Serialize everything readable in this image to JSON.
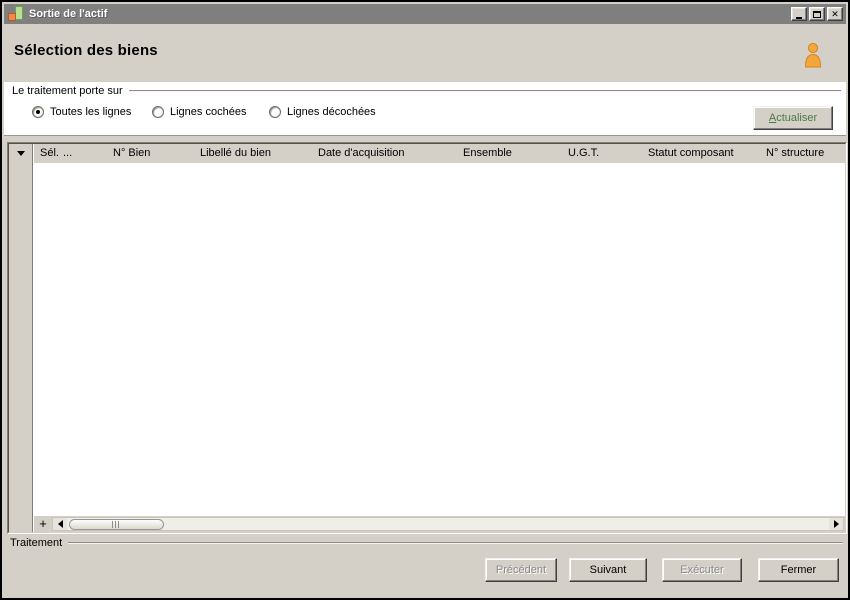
{
  "window": {
    "title": "Sortie de l'actif"
  },
  "page": {
    "heading": "Sélection des biens"
  },
  "filter_panel": {
    "legend": "Le traitement porte sur",
    "options": [
      {
        "label": "Toutes les lignes",
        "selected": true
      },
      {
        "label": "Lignes cochées",
        "selected": false
      },
      {
        "label": "Lignes décochées",
        "selected": false
      }
    ],
    "refresh_button": {
      "shortcut_letter": "A",
      "rest": "ctualiser"
    }
  },
  "table": {
    "columns": [
      "Sél.",
      "...",
      "N° Bien",
      "Libellé du bien",
      "Date d'acquisition",
      "Ensemble",
      "U.G.T.",
      "Statut composant",
      "N° structure"
    ],
    "rows": [],
    "add_row_label": "+"
  },
  "footer": {
    "group_label": "Traitement",
    "buttons": [
      {
        "label": "Précédent",
        "enabled": false
      },
      {
        "label": "Suivant",
        "enabled": true
      },
      {
        "label": "Exécuter",
        "enabled": false
      },
      {
        "label": "Fermer",
        "enabled": true
      }
    ]
  },
  "colors": {
    "titlebar_bg": "#7f7f7f",
    "dialog_bg": "#d4d0c8",
    "panel_bg": "#ffffff",
    "refresh_text": "#4a7a4a",
    "user_icon_fill": "#f2a73d"
  }
}
